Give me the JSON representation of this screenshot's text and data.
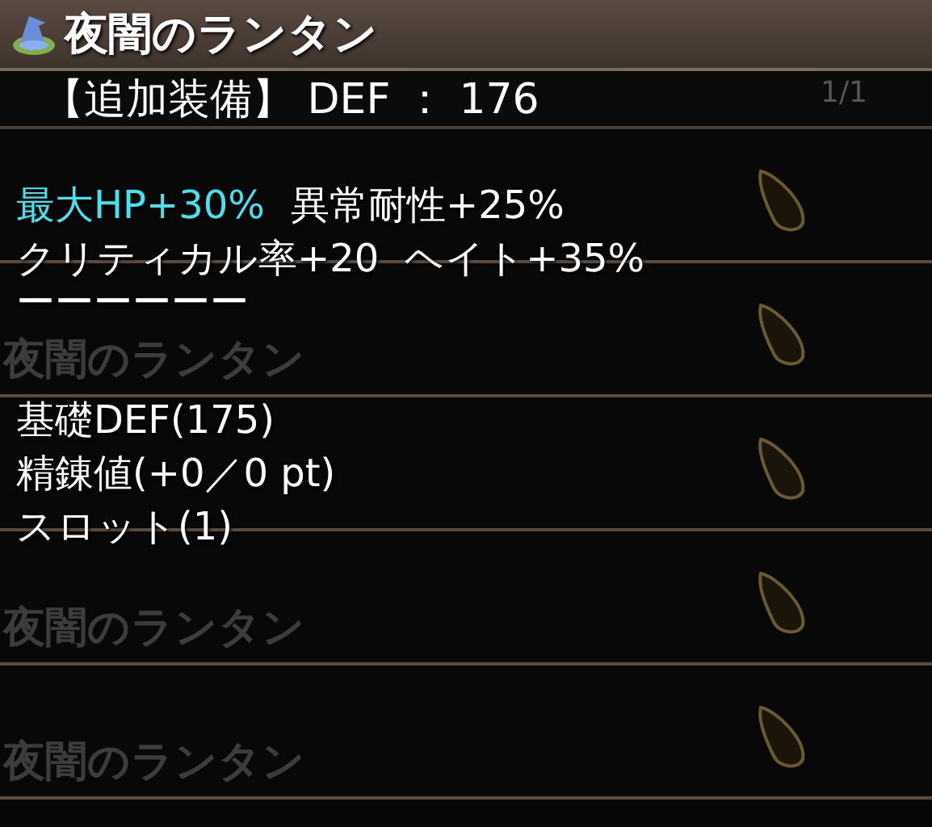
{
  "header": {
    "title": "夜闇のランタン",
    "page": "1/1"
  },
  "subtitle": "【追加装備】 DEF ： 176",
  "list_rows": [
    {},
    {
      "name": "夜闇のランタン"
    },
    {},
    {
      "name": "夜闇のランタン"
    },
    {
      "name": "夜闇のランタン"
    }
  ],
  "tooltip": {
    "lines": [
      {
        "segments": [
          {
            "text": "最大HP+30%",
            "kind": "highlight"
          },
          {
            "text": "異常耐性+25%",
            "kind": "normal"
          }
        ]
      },
      {
        "segments": [
          {
            "text": "クリティカル率+20",
            "kind": "normal"
          },
          {
            "text": "ヘイト+35%",
            "kind": "normal"
          }
        ]
      },
      {
        "segments": [
          {
            "text": "ーーーーーー",
            "kind": "normal"
          }
        ],
        "kind": "rule"
      },
      {
        "segments": [
          {
            "text": "基礎DEF(175)",
            "kind": "normal"
          }
        ]
      },
      {
        "segments": [
          {
            "text": "精錬値(+0／0 pt)",
            "kind": "normal"
          }
        ]
      },
      {
        "segments": [
          {
            "text": "スロット(1)",
            "kind": "normal"
          }
        ]
      }
    ]
  }
}
